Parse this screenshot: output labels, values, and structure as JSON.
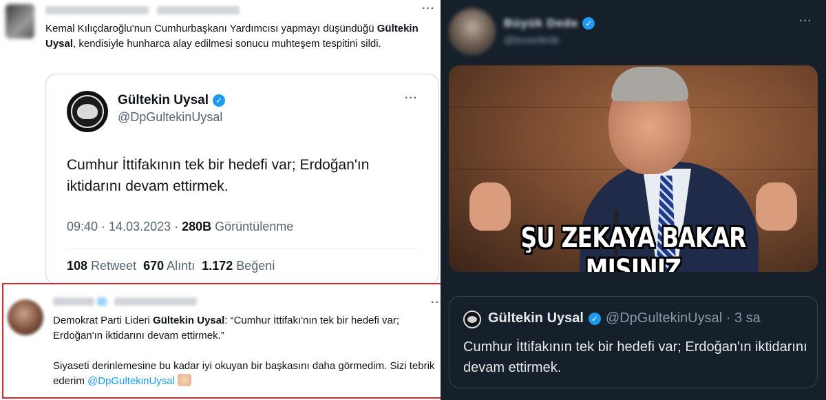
{
  "left": {
    "tweet1": {
      "text_before": "Kemal Kılıçdaroğlu'nun Cumhurbaşkanı Yardımcısı yapmayı düşündüğü",
      "text_bold": "Gültekin Uysal",
      "text_after": ", kendisiyle hunharca alay edilmesi sonucu muhteşem tespitini sildi.",
      "more": "···"
    },
    "quoted": {
      "name": "Gültekin Uysal",
      "handle": "@DpGultekinUysal",
      "more": "···",
      "body": "Cumhur İttifakının tek bir hedefi var; Erdoğan'ın iktidarını devam ettirmek.",
      "time": "09:40 · 14.03.2023 · ",
      "views_count": "280B",
      "views_label": " Görüntülenme",
      "retweets_count": "108",
      "retweets_label": "Retweet",
      "quotes_count": "670",
      "quotes_label": "Alıntı",
      "likes_count": "1.172",
      "likes_label": "Beğeni"
    },
    "reply": {
      "more": "···",
      "text_before": "Demokrat Parti Lideri ",
      "text_bold": "Gültekin Uysal",
      "text_after": ": “Cumhur İttifakı'nın tek bir hedefi var; Erdoğan'ın iktidarını devam ettirmek.”",
      "text2": "Siyaseti derinlemesine bu kadar iyi okuyan bir başkasını daha görmedim. Sizi tebrik ederim ",
      "mention": "@DpGultekinUysal"
    }
  },
  "right": {
    "author_name": "Büyük Dede",
    "author_handle": "@busedede",
    "more": "···",
    "meme_caption": "ŞU ZEKAYA BAKAR MISINIZ",
    "quoted": {
      "name": "Gültekin Uysal",
      "handle": "@DpGultekinUysal · 3 sa",
      "body": "Cumhur İttifakının tek bir hedefi var; Erdoğan'ın iktidarını devam ettirmek."
    }
  },
  "colors": {
    "accent": "#1d9bf0",
    "highlight_border": "#e0262c",
    "dark_bg": "#15202b"
  }
}
